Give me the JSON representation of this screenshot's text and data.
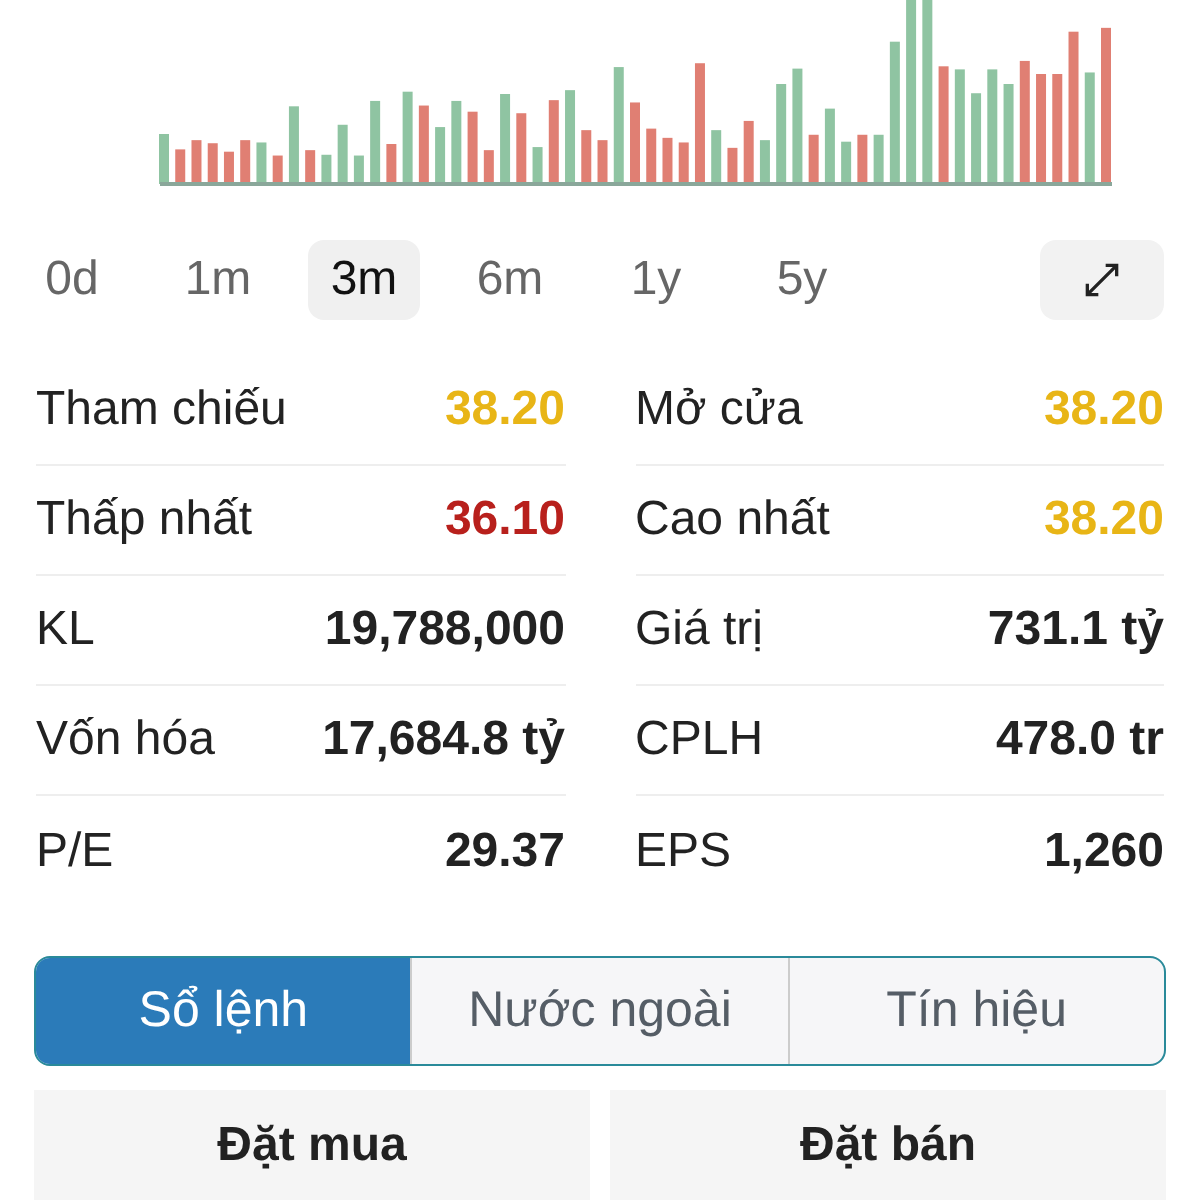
{
  "ranges": [
    {
      "label": "0d",
      "selected": false
    },
    {
      "label": "1m",
      "selected": false
    },
    {
      "label": "3m",
      "selected": true
    },
    {
      "label": "6m",
      "selected": false
    },
    {
      "label": "1y",
      "selected": false
    },
    {
      "label": "5y",
      "selected": false
    }
  ],
  "stats": [
    [
      {
        "label": "Tham chiếu",
        "value": "38.20",
        "color": "#e8b516"
      },
      {
        "label": "Mở cửa",
        "value": "38.20",
        "color": "#e8b516"
      }
    ],
    [
      {
        "label": "Thấp nhất",
        "value": "36.10",
        "color": "#b8201c"
      },
      {
        "label": "Cao nhất",
        "value": "38.20",
        "color": "#e8b516"
      }
    ],
    [
      {
        "label": "KL",
        "value": "19,788,000",
        "color": "#222222"
      },
      {
        "label": "Giá trị",
        "value": "731.1 tỷ",
        "color": "#222222"
      }
    ],
    [
      {
        "label": "Vốn hóa",
        "value": "17,684.8 tỷ",
        "color": "#222222"
      },
      {
        "label": "CPLH",
        "value": "478.0 tr",
        "color": "#222222"
      }
    ],
    [
      {
        "label": "P/E",
        "value": "29.37",
        "color": "#222222"
      },
      {
        "label": "EPS",
        "value": "1,260",
        "color": "#222222"
      }
    ]
  ],
  "tabs": [
    {
      "label": "Sổ lệnh",
      "selected": true
    },
    {
      "label": "Nước ngoài",
      "selected": false
    },
    {
      "label": "Tín hiệu",
      "selected": false
    }
  ],
  "actions": [
    "Đặt mua",
    "Đặt bán"
  ]
}
